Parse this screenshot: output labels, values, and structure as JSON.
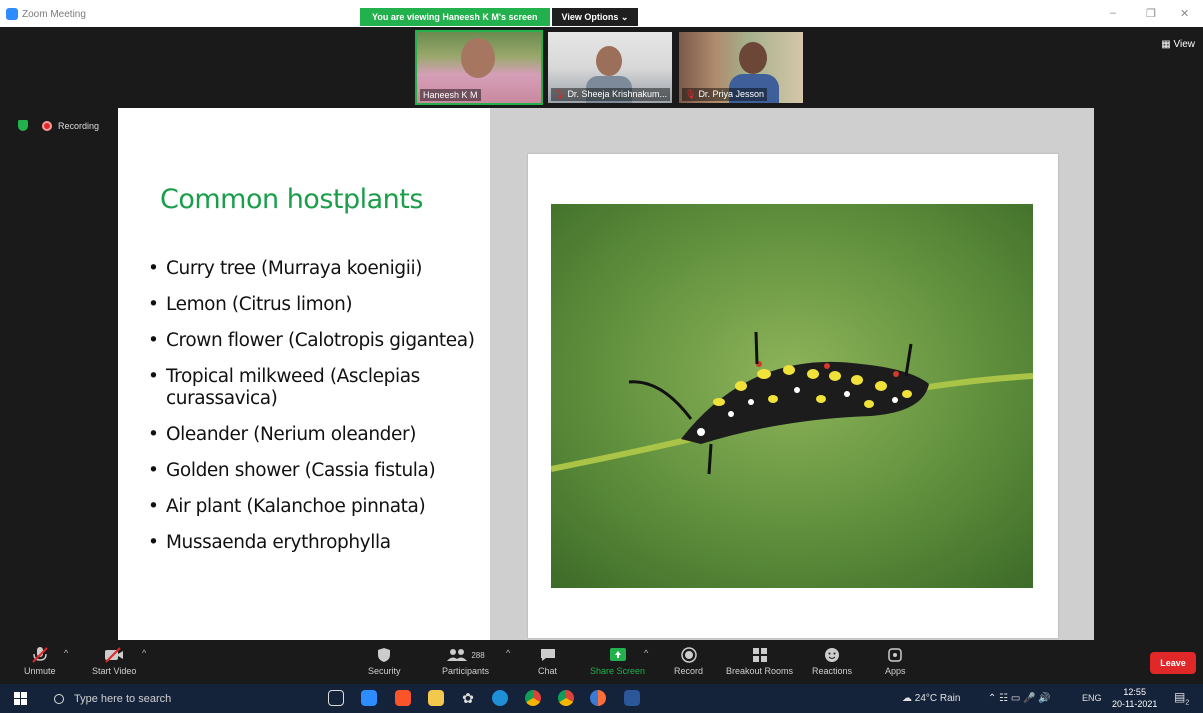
{
  "window": {
    "title": "Zoom Meeting",
    "minimize": "–",
    "restore": "❐",
    "close": "✕"
  },
  "share_banner": {
    "viewing_text": "You are viewing Haneesh K M's screen",
    "view_options": "View Options ⌄"
  },
  "view_button": "▦ View",
  "recording_label": "Recording",
  "participants": [
    {
      "name": "Haneesh K M",
      "muted": false
    },
    {
      "name": "Dr. Sheeja Krishnakum...",
      "muted": true
    },
    {
      "name": "Dr. Priya Jesson",
      "muted": true
    }
  ],
  "slide": {
    "heading": "Common hostplants",
    "bullets": [
      "Curry tree (Murraya koenigii)",
      "Lemon (Citrus limon)",
      "Crown flower (Calotropis gigantea)",
      "Tropical milkweed (Asclepias curassavica)",
      "Oleander (Nerium oleander)",
      "Golden shower (Cassia fistula)",
      "Air plant (Kalanchoe pinnata)",
      "Mussaenda erythrophylla"
    ],
    "heading_color": "#1a9e4a"
  },
  "toolbar": {
    "unmute": "Unmute",
    "start_video": "Start Video",
    "security": "Security",
    "participants": "Participants",
    "participants_count": "288",
    "chat": "Chat",
    "share_screen": "Share Screen",
    "record": "Record",
    "breakout_rooms": "Breakout Rooms",
    "reactions": "Reactions",
    "apps": "Apps",
    "leave": "Leave"
  },
  "taskbar": {
    "search_placeholder": "Type here to search",
    "weather": "24°C Rain",
    "language": "ENG",
    "time": "12:55",
    "date": "20-11-2021",
    "notification_count": "2"
  },
  "colors": {
    "accent_green": "#23b14d",
    "leave_red": "#e02828",
    "taskbar": "#14223a"
  }
}
